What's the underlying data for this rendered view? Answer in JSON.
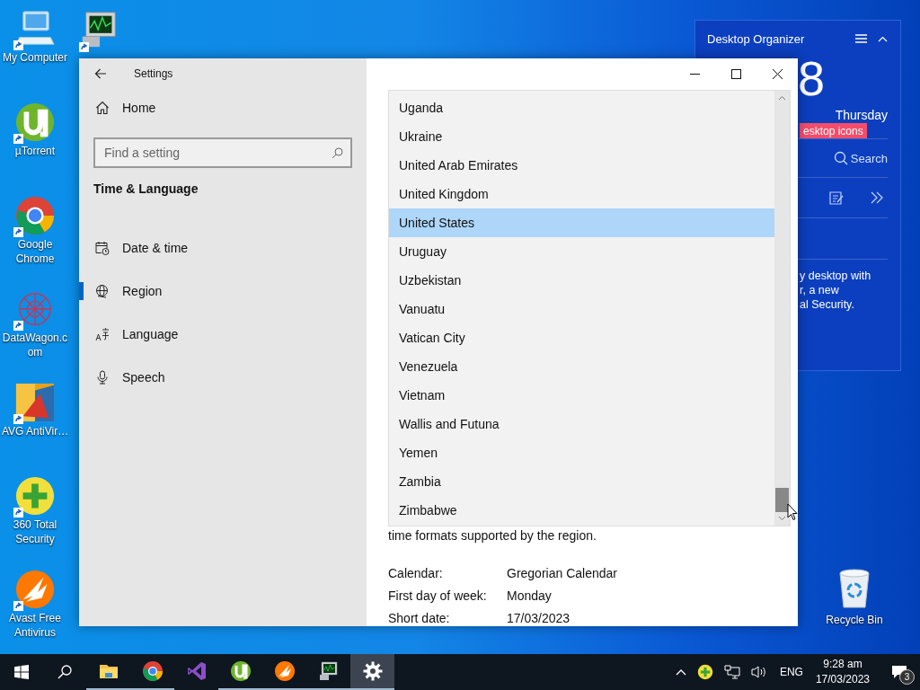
{
  "desktop_icons": [
    {
      "kind": "computer",
      "label": "My Computer"
    },
    {
      "kind": "utorrent",
      "label": "µTorrent"
    },
    {
      "kind": "chrome",
      "label": "Google Chrome"
    },
    {
      "kind": "datawagon",
      "label": "DataWagon.com"
    },
    {
      "kind": "avg",
      "label": "AVG AntiVir…"
    },
    {
      "kind": "total360",
      "label": "360 Total Security"
    },
    {
      "kind": "avast",
      "label": "Avast Free Antivirus"
    }
  ],
  "recycle_bin": {
    "label": "Recycle Bin"
  },
  "widget": {
    "title": "Desktop Organizer",
    "clock_digit": "8",
    "day": "Thursday",
    "tag": "esktop icons",
    "search": "Search",
    "text_lines": [
      "y desktop with",
      "r, a new",
      "al Security."
    ]
  },
  "window": {
    "title": "Settings",
    "home": "Home",
    "search": {
      "placeholder": "Find a setting"
    },
    "section": "Time & Language",
    "nav": [
      {
        "kind": "date",
        "label": "Date & time",
        "selected": false
      },
      {
        "kind": "region",
        "label": "Region",
        "selected": true
      },
      {
        "kind": "language",
        "label": "Language",
        "selected": false
      },
      {
        "kind": "speech",
        "label": "Speech",
        "selected": false
      }
    ],
    "country_list": [
      {
        "name": "Uganda",
        "selected": false
      },
      {
        "name": "Ukraine",
        "selected": false
      },
      {
        "name": "United Arab Emirates",
        "selected": false
      },
      {
        "name": "United Kingdom",
        "selected": false
      },
      {
        "name": "United States",
        "selected": true
      },
      {
        "name": "Uruguay",
        "selected": false
      },
      {
        "name": "Uzbekistan",
        "selected": false
      },
      {
        "name": "Vanuatu",
        "selected": false
      },
      {
        "name": "Vatican City",
        "selected": false
      },
      {
        "name": "Venezuela",
        "selected": false
      },
      {
        "name": "Vietnam",
        "selected": false
      },
      {
        "name": "Wallis and Futuna",
        "selected": false
      },
      {
        "name": "Yemen",
        "selected": false
      },
      {
        "name": "Zambia",
        "selected": false
      },
      {
        "name": "Zimbabwe",
        "selected": false
      }
    ],
    "description": "time formats supported by the region.",
    "details": [
      {
        "label": "Calendar:",
        "value": "Gregorian Calendar"
      },
      {
        "label": "First day of week:",
        "value": "Monday"
      },
      {
        "label": "Short date:",
        "value": "17/03/2023"
      }
    ]
  },
  "taskbar": {
    "apps": [
      {
        "kind": "folder",
        "running": true,
        "active": false
      },
      {
        "kind": "chrome",
        "running": true,
        "active": false
      },
      {
        "kind": "vs",
        "running": false,
        "active": false
      },
      {
        "kind": "utorrent",
        "running": true,
        "active": false
      },
      {
        "kind": "avast",
        "running": true,
        "active": false
      },
      {
        "kind": "monitor",
        "running": true,
        "active": false
      },
      {
        "kind": "settings",
        "running": true,
        "active": true
      }
    ],
    "language": "ENG",
    "time": "9:28 am",
    "date": "17/03/2023",
    "notifications": "3"
  }
}
